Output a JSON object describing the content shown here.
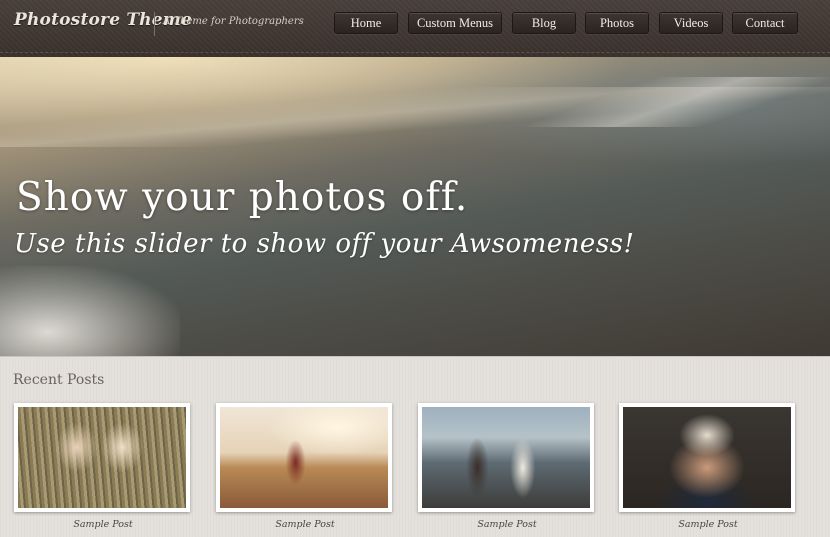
{
  "header": {
    "logo": "Photostore Theme",
    "tagline": "A Theme for Photographers",
    "nav": [
      {
        "label": "Home"
      },
      {
        "label": "Custom Menus"
      },
      {
        "label": "Blog"
      },
      {
        "label": "Photos"
      },
      {
        "label": "Videos"
      },
      {
        "label": "Contact"
      }
    ]
  },
  "hero": {
    "title": "Show your photos off.",
    "subtitle": "Use this slider to show off your Awsomeness!"
  },
  "recent_posts": {
    "heading": "Recent Posts",
    "items": [
      {
        "caption": "Sample Post"
      },
      {
        "caption": "Sample Post"
      },
      {
        "caption": "Sample Post"
      },
      {
        "caption": "Sample Post"
      }
    ]
  }
}
